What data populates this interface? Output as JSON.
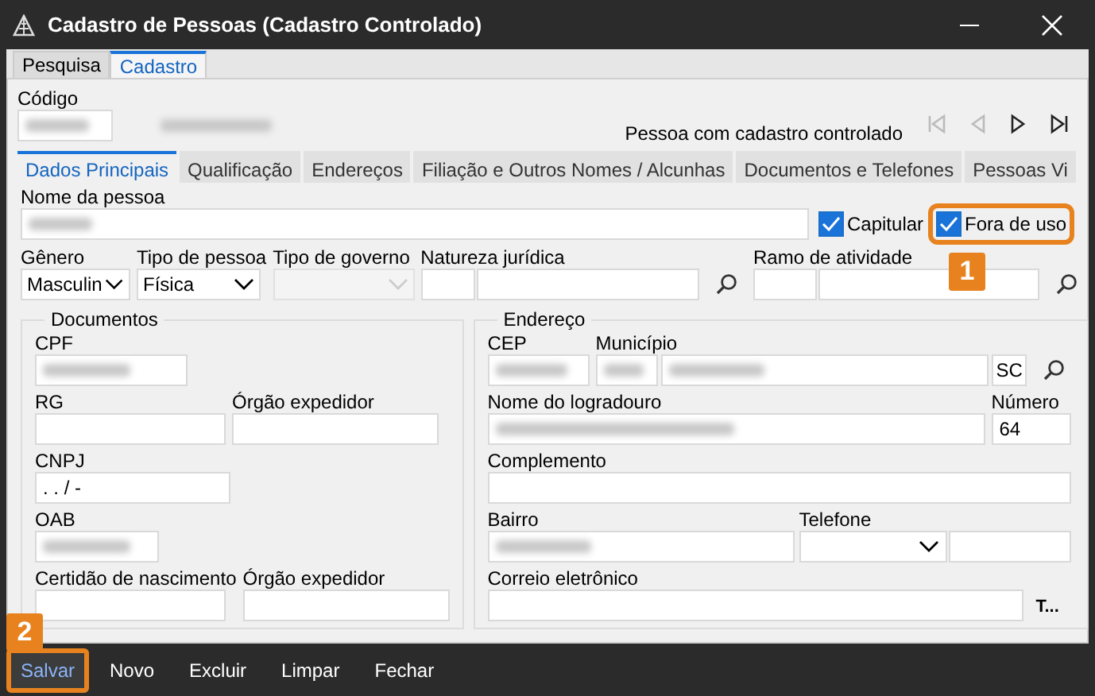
{
  "window": {
    "title": "Cadastro de Pessoas (Cadastro Controlado)"
  },
  "outer_tabs": [
    {
      "label": "Pesquisa",
      "selected": false
    },
    {
      "label": "Cadastro",
      "selected": true
    }
  ],
  "codigo": {
    "label": "Código",
    "redacted": true
  },
  "record_status": "Pessoa com cadastro controlado",
  "nav_buttons": [
    {
      "kind": "first",
      "disabled": true
    },
    {
      "kind": "prev",
      "disabled": true
    },
    {
      "kind": "next",
      "disabled": false
    },
    {
      "kind": "last",
      "disabled": false
    }
  ],
  "inner_tabs": [
    {
      "label": "Dados Principais",
      "selected": true
    },
    {
      "label": "Qualificação",
      "selected": false
    },
    {
      "label": "Endereços",
      "selected": false
    },
    {
      "label": "Filiação e Outros Nomes / Alcunhas",
      "selected": false
    },
    {
      "label": "Documentos e Telefones",
      "selected": false
    },
    {
      "label": "Pessoas Vi",
      "selected": false
    }
  ],
  "nome": {
    "label": "Nome da pessoa",
    "redacted": true
  },
  "checkboxes": [
    {
      "label": "Capitular",
      "checked": true
    },
    {
      "label": "Fora de uso",
      "checked": true,
      "callout": "1"
    }
  ],
  "classification": [
    {
      "label": "Gênero",
      "kind": "select",
      "value": "Masculin",
      "disabled": false
    },
    {
      "label": "Tipo de pessoa",
      "kind": "select",
      "value": "Física",
      "disabled": false
    },
    {
      "label": "Tipo de governo",
      "kind": "select",
      "disabled": true
    },
    {
      "label": "Natureza jurídica",
      "kind": "lookup"
    },
    {
      "label": "Ramo de atividade",
      "kind": "lookup"
    }
  ],
  "documentos": {
    "title": "Documentos",
    "rows": [
      [
        {
          "label": "CPF",
          "redacted": true
        }
      ],
      [
        {
          "label": "RG",
          "redacted": false
        },
        {
          "label": "Órgão expedidor",
          "redacted": false
        }
      ],
      [
        {
          "label": "CNPJ",
          "value": " .  .  /   -",
          "redacted": false
        }
      ],
      [
        {
          "label": "OAB",
          "redacted": true
        }
      ],
      [
        {
          "label": "Certidão de nascimento",
          "redacted": false
        },
        {
          "label": "Órgão expedidor",
          "redacted": false
        }
      ]
    ]
  },
  "endereco": {
    "title": "Endereço",
    "cep": {
      "label": "CEP",
      "redacted": true
    },
    "municipio": {
      "label": "Município",
      "redacted": true,
      "uf": "SC"
    },
    "logradouro": {
      "label": "Nome do logradouro",
      "redacted": true
    },
    "numero": {
      "label": "Número",
      "value": "64"
    },
    "complemento": {
      "label": "Complemento"
    },
    "bairro": {
      "label": "Bairro",
      "redacted": true
    },
    "telefone": {
      "label": "Telefone"
    },
    "email": {
      "label": "Correio eletrônico",
      "button": "T..."
    }
  },
  "buttons": [
    {
      "label": "Salvar",
      "focused": true,
      "callout": "2"
    },
    {
      "label": "Novo",
      "focused": false
    },
    {
      "label": "Excluir",
      "focused": false
    },
    {
      "label": "Limpar",
      "focused": false
    },
    {
      "label": "Fechar",
      "focused": false
    }
  ]
}
